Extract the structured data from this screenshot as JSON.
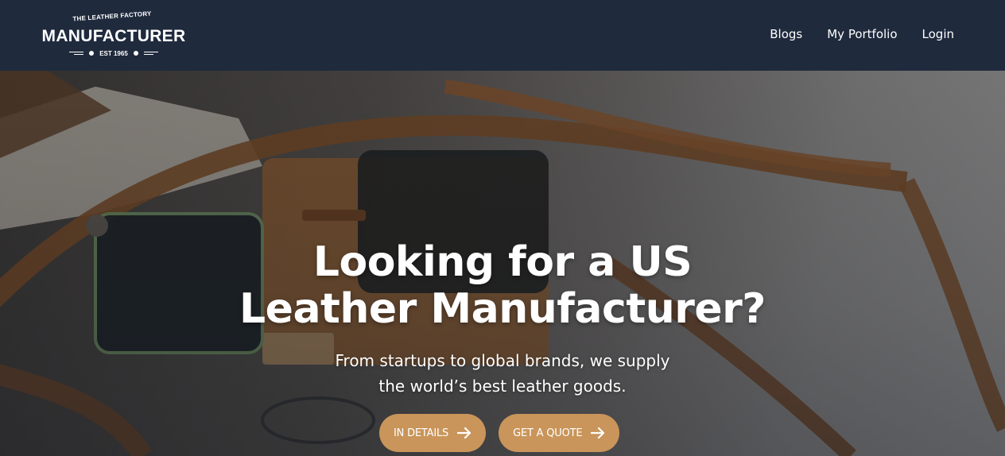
{
  "navbar": {
    "logo": {
      "tagline": "THE LEATHER FACTORY",
      "wordmark": "MANUFACTURER",
      "established": "EST 1965"
    },
    "links": [
      "Blogs",
      "My Portfolio",
      "Login"
    ]
  },
  "hero": {
    "headline_line1": "Looking for a US",
    "headline_line2": "Leather Manufacturer?",
    "subtext_line1": "From startups to global brands, we supply",
    "subtext_line2": "the world’s best leather goods.",
    "buttons": [
      {
        "label": "IN DETAILS",
        "icon": "arrow-right-icon"
      },
      {
        "label": "GET A QUOTE",
        "icon": "arrow-right-icon"
      }
    ]
  },
  "colors": {
    "navbar_bg": "#1f2a3d",
    "button_bg": "#c9955a",
    "text": "#ffffff"
  }
}
